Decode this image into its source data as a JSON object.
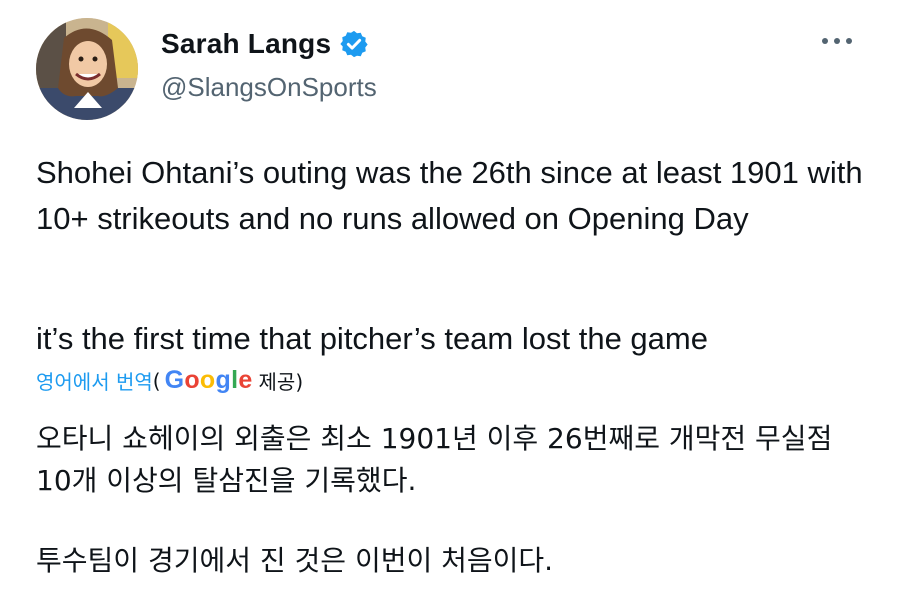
{
  "author": {
    "display_name": "Sarah Langs",
    "handle": "@SlangsOnSports",
    "verified_icon": "verified-badge-icon",
    "avatar": "avatar-illustration"
  },
  "tweet": {
    "paragraph_1": "Shohei Ohtani’s outing was the 26th since at least 1901 with 10+ strikeouts and no runs allowed on Opening Day",
    "paragraph_2": "it’s the first time that pitcher’s team lost the game"
  },
  "translation": {
    "link_label": "영어에서 번역",
    "provided_prefix": "(",
    "provider_logo": "Google",
    "provided_suffix": "제공)",
    "paragraph_1": "오타니 쇼헤이의 외출은 최소 1901년 이후 26번째로 개막전 무실점 10개 이상의 탈삼진을 기록했다.",
    "paragraph_2": "투수팀이 경기에서 진 것은 이번이 처음이다."
  },
  "menu": {
    "icon": "more-options-icon"
  },
  "colors": {
    "text": "#0f1419",
    "secondary": "#536471",
    "accent": "#1d9bf0"
  }
}
